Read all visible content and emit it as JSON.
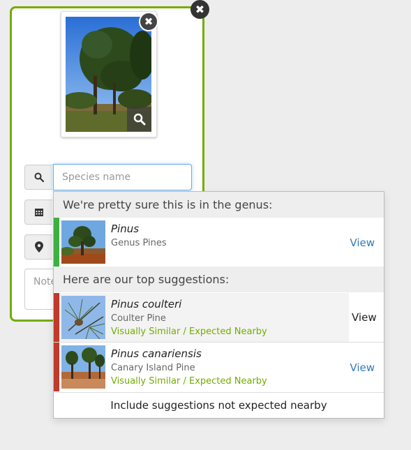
{
  "card": {
    "close_icon": "close-icon",
    "photo": {
      "remove_icon": "close-icon",
      "zoom_icon": "search-icon"
    },
    "species_field": {
      "placeholder": "Species name",
      "icon": "search-icon"
    },
    "date_field": {
      "icon": "calendar-icon"
    },
    "location_field": {
      "icon": "map-marker-icon"
    },
    "notes_field": {
      "placeholder": "Notes"
    }
  },
  "suggestions": {
    "genus_heading": "We're pretty sure this is in the genus:",
    "genus": {
      "name": "Pinus",
      "common": "Genus Pines",
      "view": "View",
      "accent": "#3cb043"
    },
    "top_heading": "Here are our top suggestions:",
    "items": [
      {
        "name": "Pinus coulteri",
        "common": "Coulter Pine",
        "tag_visual": "Visually Similar",
        "tag_sep": "/",
        "tag_nearby": "Expected Nearby",
        "view": "View",
        "accent": "#c0392b"
      },
      {
        "name": "Pinus canariensis",
        "common": "Canary Island Pine",
        "tag_visual": "Visually Similar",
        "tag_sep": "/",
        "tag_nearby": "Expected Nearby",
        "view": "View",
        "accent": "#c0392b"
      }
    ],
    "footer": "Include suggestions not expected nearby"
  },
  "colors": {
    "brand_green": "#74ac00",
    "link_blue": "#337ab7",
    "genus_accent": "#3cb043",
    "species_accent": "#c0392b"
  }
}
